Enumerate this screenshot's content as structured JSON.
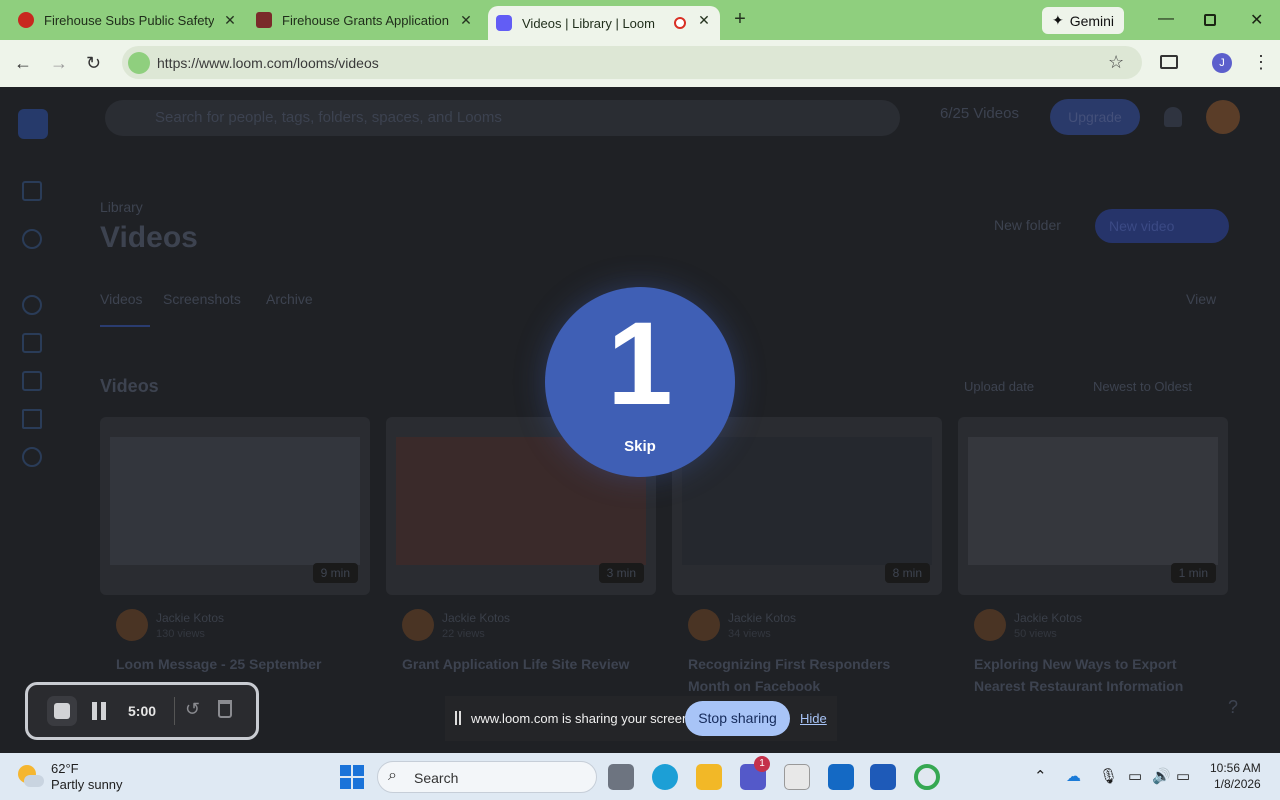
{
  "browser": {
    "tabs": [
      {
        "title": "Firehouse Subs Public Safety Fo",
        "favicon": "firehouse-favicon"
      },
      {
        "title": "Firehouse Grants Application",
        "favicon": "firehouse-grants-favicon"
      },
      {
        "title": "Videos | Library | Loom",
        "favicon": "loom-favicon",
        "active": true
      }
    ],
    "new_tab_label": "+",
    "gemini_label": "Gemini",
    "url": "https://www.loom.com/looms/videos",
    "profile_initial": "J"
  },
  "loom": {
    "search_placeholder": "Search for people, tags, folders, spaces, and Looms",
    "video_count": "6/25 Videos",
    "upgrade_label": "Upgrade",
    "breadcrumb": "Library",
    "page_title": "Videos",
    "new_folder_label": "New folder",
    "new_video_label": "New video",
    "tabs": [
      "Videos",
      "Screenshots",
      "Archive"
    ],
    "view_label": "View",
    "section_title": "Videos",
    "sort_by": "Upload date",
    "sort_order": "Newest to Oldest",
    "cards": [
      {
        "duration": "9 min",
        "author": "Jackie Kotos",
        "meta": "130 views",
        "title": "Loom Message - 25 September"
      },
      {
        "duration": "3 min",
        "author": "Jackie Kotos",
        "meta": "22 views",
        "title": "Grant Application Life Site Review"
      },
      {
        "duration": "8 min",
        "author": "Jackie Kotos",
        "meta": "34 views",
        "title": "Recognizing First Responders Month on Facebook"
      },
      {
        "duration": "1 min",
        "author": "Jackie Kotos",
        "meta": "50 views",
        "title": "Exploring New Ways to Export Nearest Restaurant Information"
      }
    ]
  },
  "recording": {
    "countdown": "1",
    "skip_label": "Skip",
    "timer": "5:00"
  },
  "share_bar": {
    "message": "www.loom.com is sharing your screen.",
    "stop_label": "Stop sharing",
    "hide_label": "Hide"
  },
  "taskbar": {
    "temperature": "62°F",
    "condition": "Partly sunny",
    "search_label": "Search",
    "teams_badge": "1",
    "time": "10:56 AM",
    "date": "1/8/2026"
  },
  "colors": {
    "chrome_frame": "#8fcf7e",
    "loom_blue": "#3f5fb5",
    "stop_button": "#a8c4f7"
  }
}
